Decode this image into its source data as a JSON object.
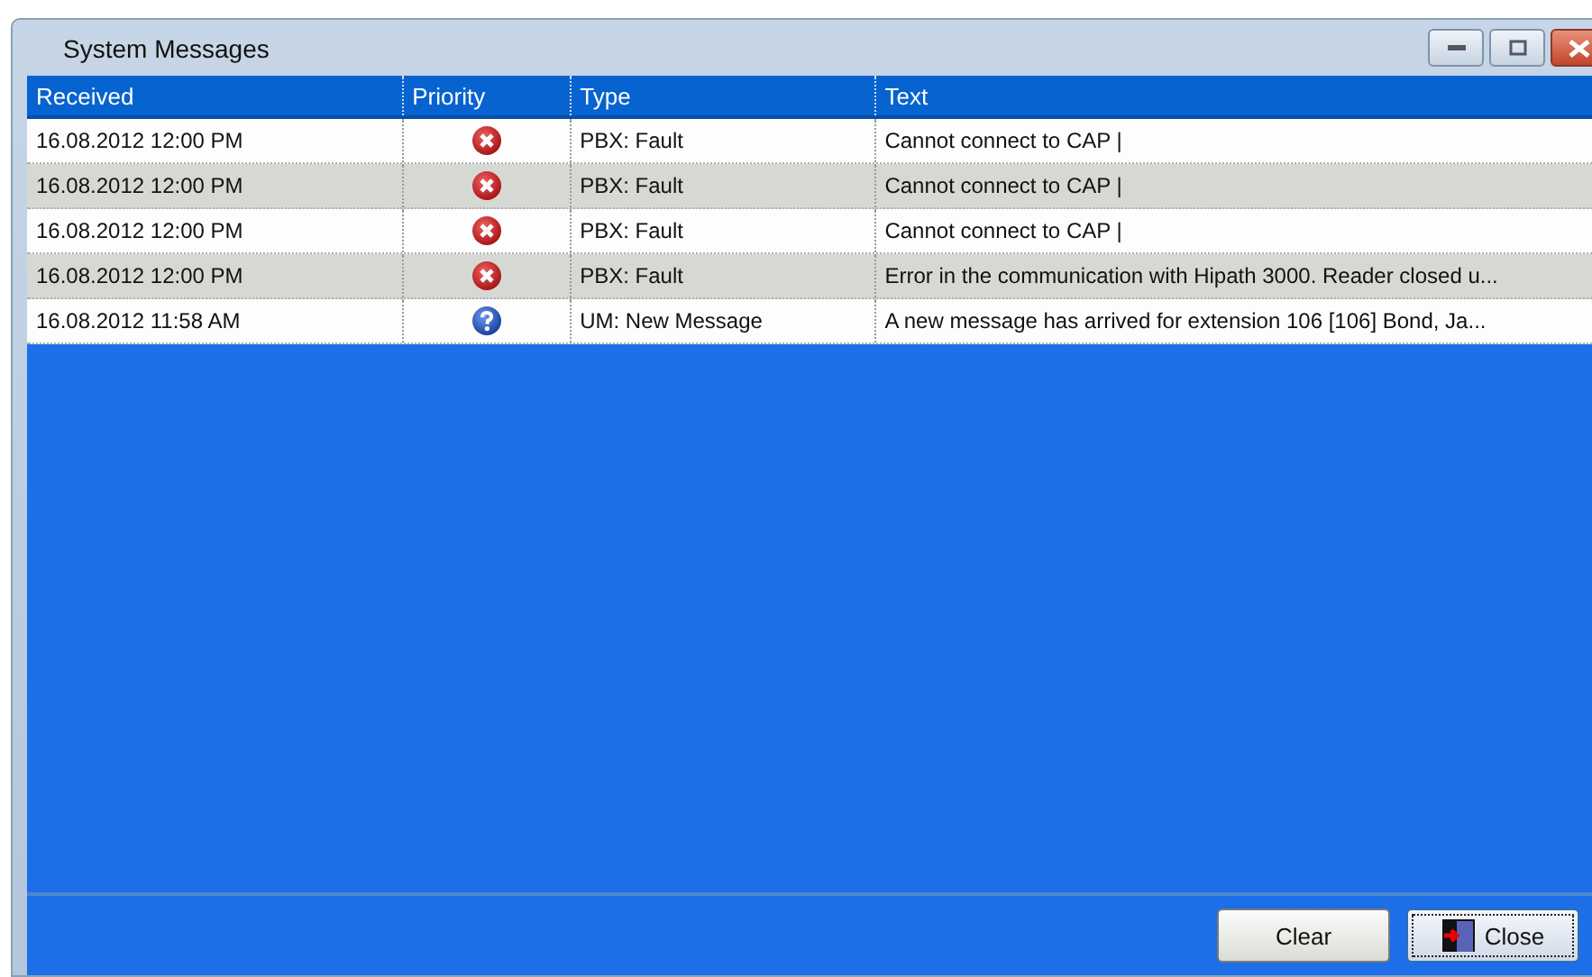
{
  "window": {
    "title": "System Messages"
  },
  "table": {
    "columns": [
      "Received",
      "Priority",
      "Type",
      "Text"
    ],
    "rows": [
      {
        "received": "16.08.2012 12:00 PM",
        "kind": "error",
        "type": "PBX: Fault",
        "text": "Cannot connect to CAP |"
      },
      {
        "received": "16.08.2012 12:00 PM",
        "kind": "error",
        "type": "PBX: Fault",
        "text": "Cannot connect to CAP |"
      },
      {
        "received": "16.08.2012 12:00 PM",
        "kind": "error",
        "type": "PBX: Fault",
        "text": "Cannot connect to CAP |"
      },
      {
        "received": "16.08.2012 12:00 PM",
        "kind": "error",
        "type": "PBX: Fault",
        "text": "Error in the communication with Hipath 3000. Reader closed u..."
      },
      {
        "received": "16.08.2012 11:58 AM",
        "kind": "info",
        "type": "UM: New Message",
        "text": "A new message has arrived for extension 106 [106] Bond, Ja..."
      }
    ]
  },
  "buttons": [
    {
      "label": "Clear",
      "kind": "plain",
      "focused": false
    },
    {
      "label": "Close",
      "kind": "exit",
      "focused": true
    }
  ]
}
